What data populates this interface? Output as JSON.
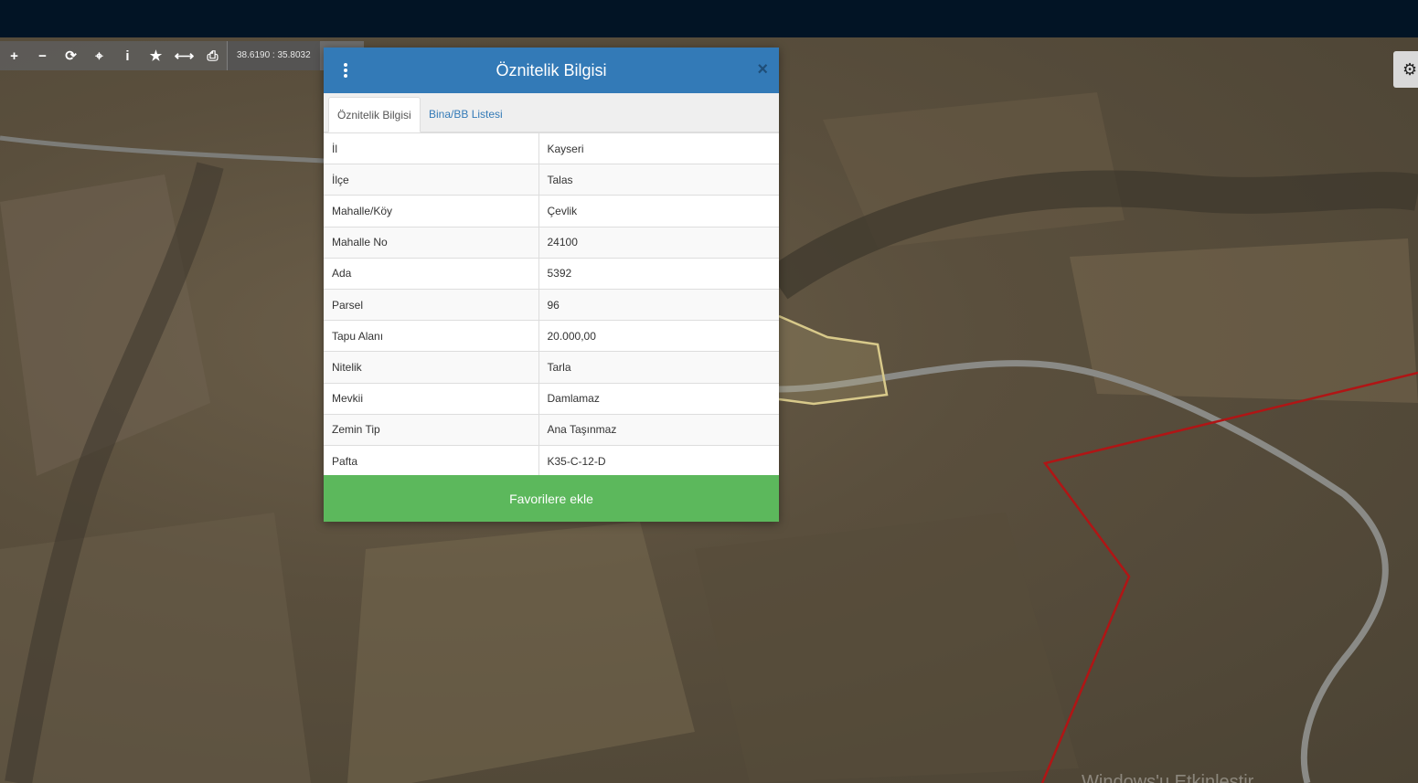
{
  "toolbar": {
    "tools": [
      {
        "name": "zoom-in-icon",
        "glyph": "+"
      },
      {
        "name": "zoom-out-icon",
        "glyph": "−"
      },
      {
        "name": "refresh-icon",
        "glyph": "⟳"
      },
      {
        "name": "locate-icon",
        "glyph": "⌖"
      },
      {
        "name": "info-icon",
        "glyph": "i"
      },
      {
        "name": "star-icon",
        "glyph": "★"
      },
      {
        "name": "measure-icon",
        "glyph": "⟷"
      },
      {
        "name": "print-icon",
        "glyph": "⎙"
      }
    ],
    "coordinates": "38.6190 : 35.8032"
  },
  "settings": {
    "icon": "gear-icon",
    "glyph": "⚙"
  },
  "watermark": "Windows'u Etkinleştir",
  "dialog": {
    "title": "Öznitelik Bilgisi",
    "close_glyph": "×",
    "tabs": [
      {
        "label": "Öznitelik Bilgisi",
        "active": true
      },
      {
        "label": "Bina/BB Listesi",
        "active": false
      }
    ],
    "rows": [
      {
        "key": "İl",
        "value": "Kayseri"
      },
      {
        "key": "İlçe",
        "value": "Talas"
      },
      {
        "key": "Mahalle/Köy",
        "value": "Çevlik"
      },
      {
        "key": "Mahalle No",
        "value": "24100"
      },
      {
        "key": "Ada",
        "value": "5392"
      },
      {
        "key": "Parsel",
        "value": "96"
      },
      {
        "key": "Tapu Alanı",
        "value": "20.000,00"
      },
      {
        "key": "Nitelik",
        "value": "Tarla"
      },
      {
        "key": "Mevkii",
        "value": "Damlamaz"
      },
      {
        "key": "Zemin Tip",
        "value": "Ana Taşınmaz"
      },
      {
        "key": "Pafta",
        "value": "K35-C-12-D"
      }
    ],
    "favorite_button": "Favorilere ekle"
  },
  "colors": {
    "header_blue": "#337ab7",
    "button_green": "#5cb85c",
    "topbar": "#021425",
    "parcel_outline": "#d8c98a",
    "boundary_red": "#b01515"
  }
}
